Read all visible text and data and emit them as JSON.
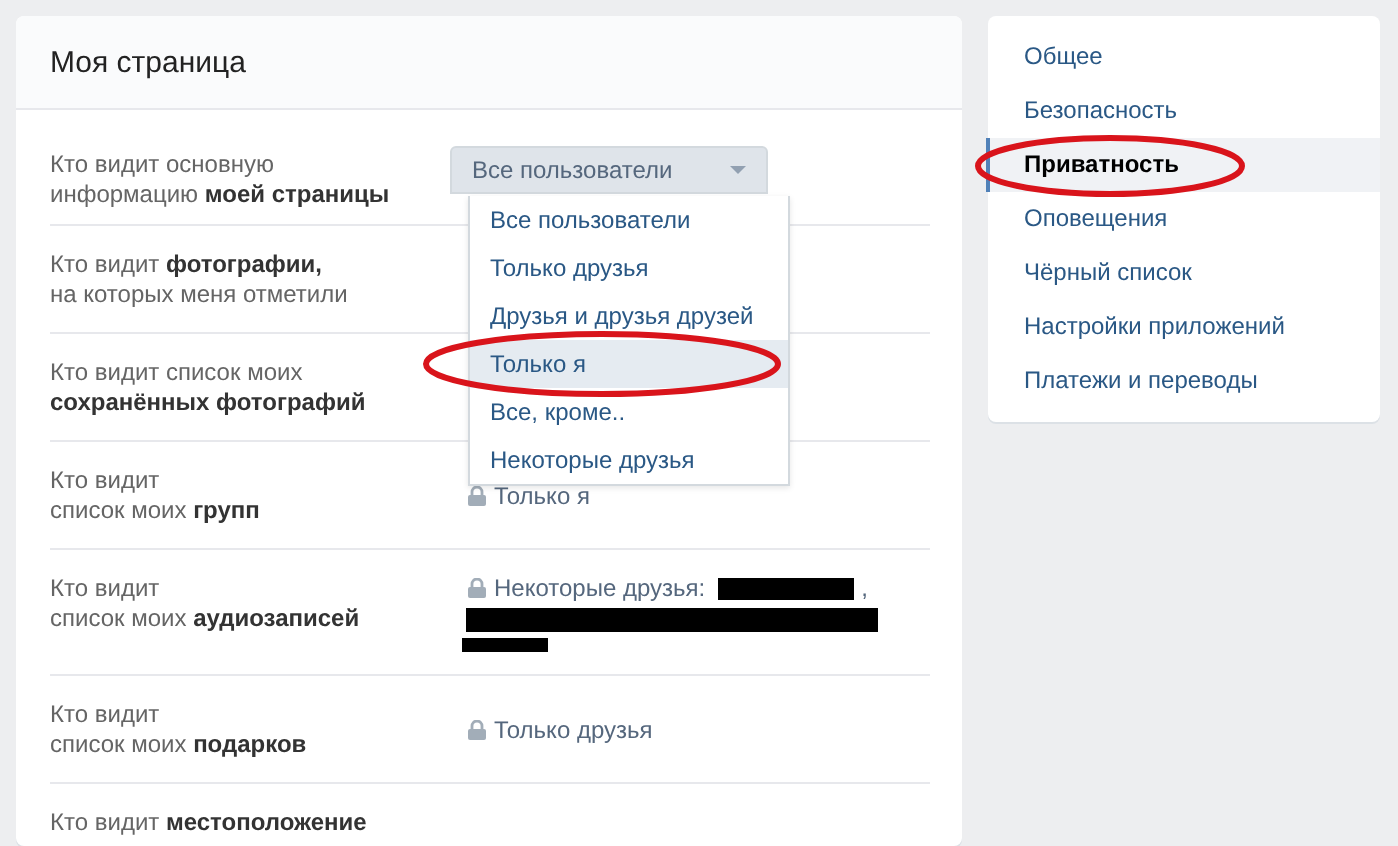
{
  "card": {
    "title": "Моя страница",
    "rows": [
      {
        "label": "Кто видит основную\nинформацию **моей страницы**",
        "value": {
          "kind": "select",
          "text": "Все пользователи",
          "options": [
            {
              "label": "Все пользователи",
              "highlighted": false,
              "circled": false
            },
            {
              "label": "Только друзья",
              "highlighted": false,
              "circled": false
            },
            {
              "label": "Друзья и друзья друзей",
              "highlighted": false,
              "circled": false
            },
            {
              "label": "Только я",
              "highlighted": true,
              "circled": true
            },
            {
              "label": "Все, кроме..",
              "highlighted": false,
              "circled": false
            },
            {
              "label": "Некоторые друзья",
              "highlighted": false,
              "circled": false
            }
          ]
        }
      },
      {
        "label": "Кто видит **фотографии,**\nна которых меня отметили"
      },
      {
        "label": "Кто видит список моих\n**сохранённых фотографий**"
      },
      {
        "label": "Кто видит\nсписок моих **групп**",
        "value": {
          "kind": "locked",
          "text": "Только я"
        }
      },
      {
        "label": "Кто видит\nсписок моих **аудиозаписей**",
        "value": {
          "kind": "locked",
          "text": "Некоторые друзья:",
          "redacted": true,
          "suffix": ","
        }
      },
      {
        "label": "Кто видит\nсписок моих **подарков**",
        "value": {
          "kind": "locked",
          "text": "Только друзья"
        }
      },
      {
        "label": "Кто видит **местоположение**"
      }
    ]
  },
  "menu": {
    "items": [
      {
        "label": "Общее",
        "selected": false,
        "circled": false
      },
      {
        "label": "Безопасность",
        "selected": false,
        "circled": false
      },
      {
        "label": "Приватность",
        "selected": true,
        "circled": true
      },
      {
        "label": "Оповещения",
        "selected": false,
        "circled": false
      },
      {
        "label": "Чёрный список",
        "selected": false,
        "circled": false
      },
      {
        "label": "Настройки приложений",
        "selected": false,
        "circled": false
      },
      {
        "label": "Платежи и переводы",
        "selected": false,
        "circled": false
      }
    ]
  }
}
